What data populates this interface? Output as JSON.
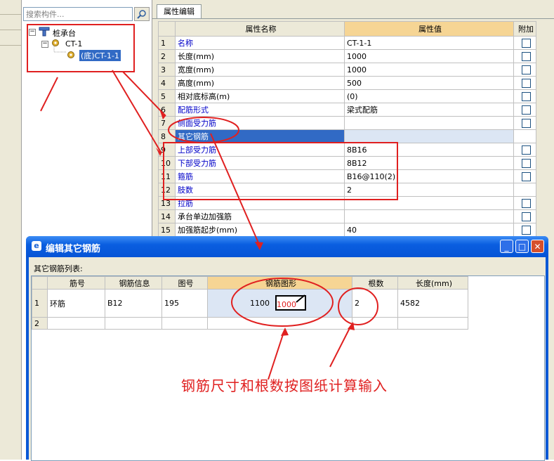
{
  "tree": {
    "search_placeholder": "搜索构件...",
    "root": "桩承台",
    "child": "CT-1",
    "leaf": "(底)CT-1-1"
  },
  "props": {
    "tab": "属性编辑",
    "col_name": "属性名称",
    "col_value": "属性值",
    "col_extra": "附加",
    "rows": [
      {
        "num": "1",
        "name": "名称",
        "value": "CT-1-1"
      },
      {
        "num": "2",
        "name": "长度(mm)",
        "value": "1000"
      },
      {
        "num": "3",
        "name": "宽度(mm)",
        "value": "1000"
      },
      {
        "num": "4",
        "name": "高度(mm)",
        "value": "500"
      },
      {
        "num": "5",
        "name": "相对底标高(m)",
        "value": "(0)"
      },
      {
        "num": "6",
        "name": "配筋形式",
        "value": "梁式配筋"
      },
      {
        "num": "7",
        "name": "侧面受力筋",
        "value": ""
      },
      {
        "num": "8",
        "name": "其它钢筋",
        "value": ""
      },
      {
        "num": "9",
        "name": "上部受力筋",
        "value": "8B16"
      },
      {
        "num": "10",
        "name": "下部受力筋",
        "value": "8B12"
      },
      {
        "num": "11",
        "name": "箍筋",
        "value": "B16@110(2)"
      },
      {
        "num": "12",
        "name": "肢数",
        "value": "2"
      },
      {
        "num": "13",
        "name": "拉筋",
        "value": ""
      },
      {
        "num": "14",
        "name": "承台单边加强筋",
        "value": ""
      },
      {
        "num": "15",
        "name": "加强筋起步(mm)",
        "value": "40"
      }
    ]
  },
  "dialog": {
    "title": "编辑其它钢筋",
    "list_label": "其它钢筋列表:",
    "cols": [
      "筋号",
      "钢筋信息",
      "图号",
      "钢筋图形",
      "根数",
      "长度(mm)"
    ],
    "row1": {
      "num": "1",
      "name": "环筋",
      "info": "B12",
      "fig": "195",
      "dim1": "1100",
      "dim2": "1000",
      "count": "2",
      "length": "4582"
    },
    "row2": {
      "num": "2"
    }
  },
  "annotation": {
    "caption": "钢筋尺寸和根数按图纸计算输入"
  },
  "colors": {
    "annotation_red": "#e02020",
    "selection_blue": "#316ac5",
    "header_orange": "#f6d594"
  }
}
